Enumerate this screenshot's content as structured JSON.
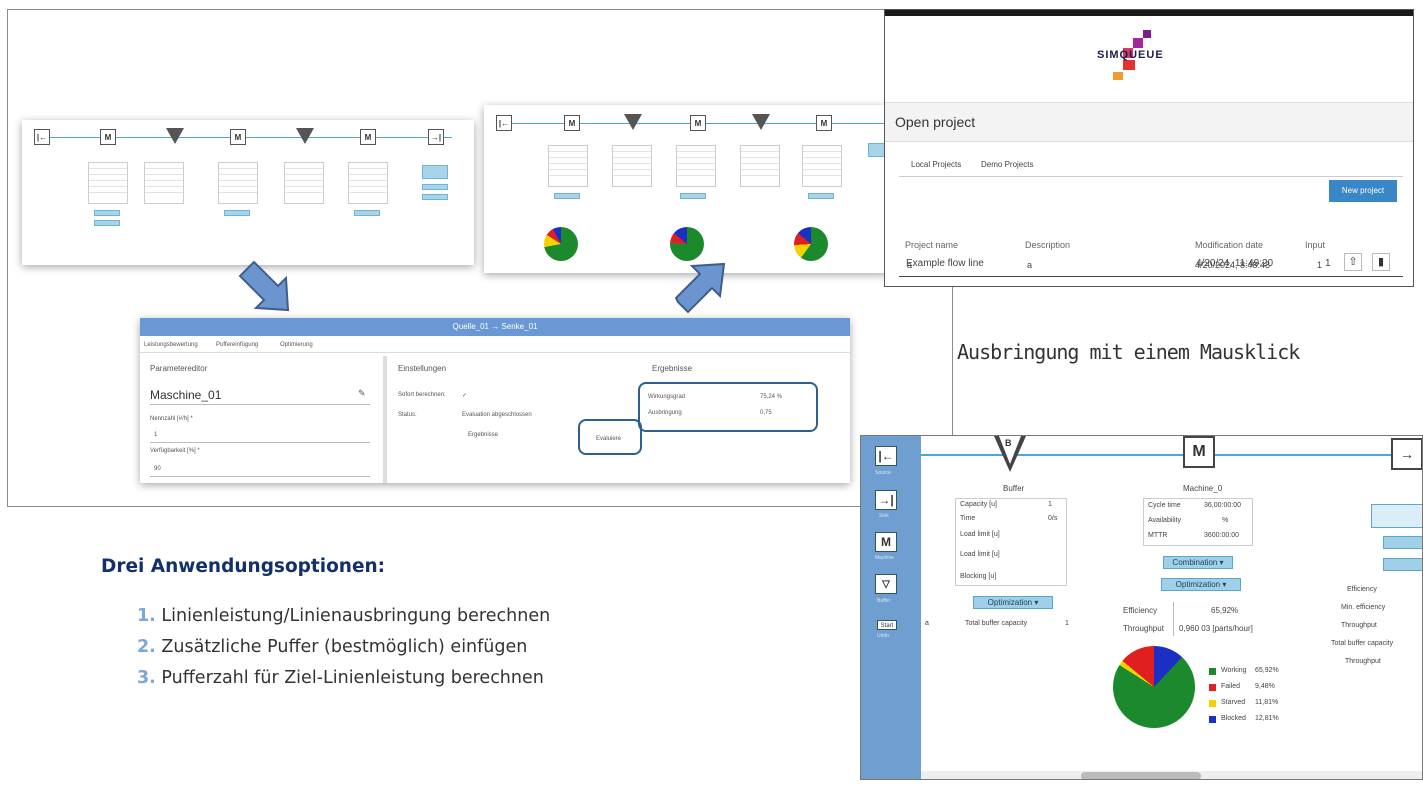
{
  "caption_right": "Ausbringung mit einem Mausklick",
  "options": {
    "heading": "Drei Anwendungsoptionen:",
    "items": [
      {
        "num": "1.",
        "text": "Linienleistung/Linienausbringung berechnen"
      },
      {
        "num": "2.",
        "text": "Zusätzliche Puffer (bestmöglich) einfügen"
      },
      {
        "num": "3.",
        "text": "Pufferzahl für Ziel-Linienleistung berechnen"
      }
    ]
  },
  "dialog": {
    "title": "Quelle_01 → Senke_01",
    "tabs": [
      "Leistungsbewertung",
      "Puffereinfügung",
      "Optimierung"
    ],
    "param_header": "Parametereditor",
    "machine_name": "Maschine_01",
    "field1_label": "Nennzahl [#/h] *",
    "field1_value": "1",
    "field2_label": "Verfügbarkeit [%] *",
    "field2_value": "90",
    "settings_header": "Einstellungen",
    "auto_calc_label": "Sofort berechnen:",
    "auto_calc_value": "✓",
    "status_label": "Status:",
    "status_value": "Evaluation abgeschlossen",
    "results_button": "Ergebnisse",
    "evaluate_button": "Evaluiere",
    "results_header": "Ergebnisse",
    "efficiency_label": "Wirkungsgrad",
    "efficiency_value": "75,24 %",
    "throughput_label": "Ausbringung",
    "throughput_value": "0,75"
  },
  "open_project": {
    "logo": "SIMQUEUE",
    "title": "Open project",
    "tabs": [
      "Local Projects",
      "Demo Projects"
    ],
    "new_button": "New project",
    "columns": [
      "Project name",
      "Description",
      "Modification date",
      "Input"
    ],
    "rows": [
      {
        "name": "a",
        "description": "a",
        "date": "4/20/2024, 8:48:48",
        "input": "1"
      },
      {
        "name": "Example flow line",
        "description": "",
        "date": "4/20/24, 11:49:20",
        "input": "1"
      }
    ]
  },
  "zoom": {
    "buffer_title": "Buffer",
    "buffer_rows": [
      "Capacity [u]",
      "Time",
      "Load limit [u]",
      "Load limit [u]",
      "Blocking [u]"
    ],
    "buffer_values": [
      "1",
      "0/s"
    ],
    "optimization_button": "Optimization ▾",
    "buffer_capacity_label": "Total buffer capacity",
    "buffer_capacity_value": "1",
    "machine_title": "Machine_0",
    "machine_rows": [
      {
        "k": "Cycle time",
        "v": "36,00:00:00"
      },
      {
        "k": "Availability",
        "v": "%"
      },
      {
        "k": "MTTR",
        "v": "3600:00:00"
      }
    ],
    "combination_button": "Combination ▾",
    "optimization_button2": "Optimization ▾",
    "efficiency_label": "Efficiency",
    "efficiency_value": "65,92%",
    "throughput_label": "Throughput",
    "throughput_value": "0,960 03 [parts/hour]",
    "legend": [
      {
        "label": "Working",
        "value": "65,92%",
        "color": "#1b8a2c"
      },
      {
        "label": "Failed",
        "value": "9,48%",
        "color": "#e02020"
      },
      {
        "label": "Starved",
        "value": "11,81%",
        "color": "#f2d200"
      },
      {
        "label": "Blocked",
        "value": "12,81%",
        "color": "#1c2fc4"
      }
    ],
    "right_labels": [
      "Efficiency",
      "Min. efficiency",
      "Throughput",
      "Total buffer capacity",
      "Throughput"
    ],
    "side_captions": [
      "Source",
      "Sink",
      "Machine",
      "Buffer",
      "Undo"
    ],
    "side_tag": "Start",
    "edge_text": "a"
  }
}
